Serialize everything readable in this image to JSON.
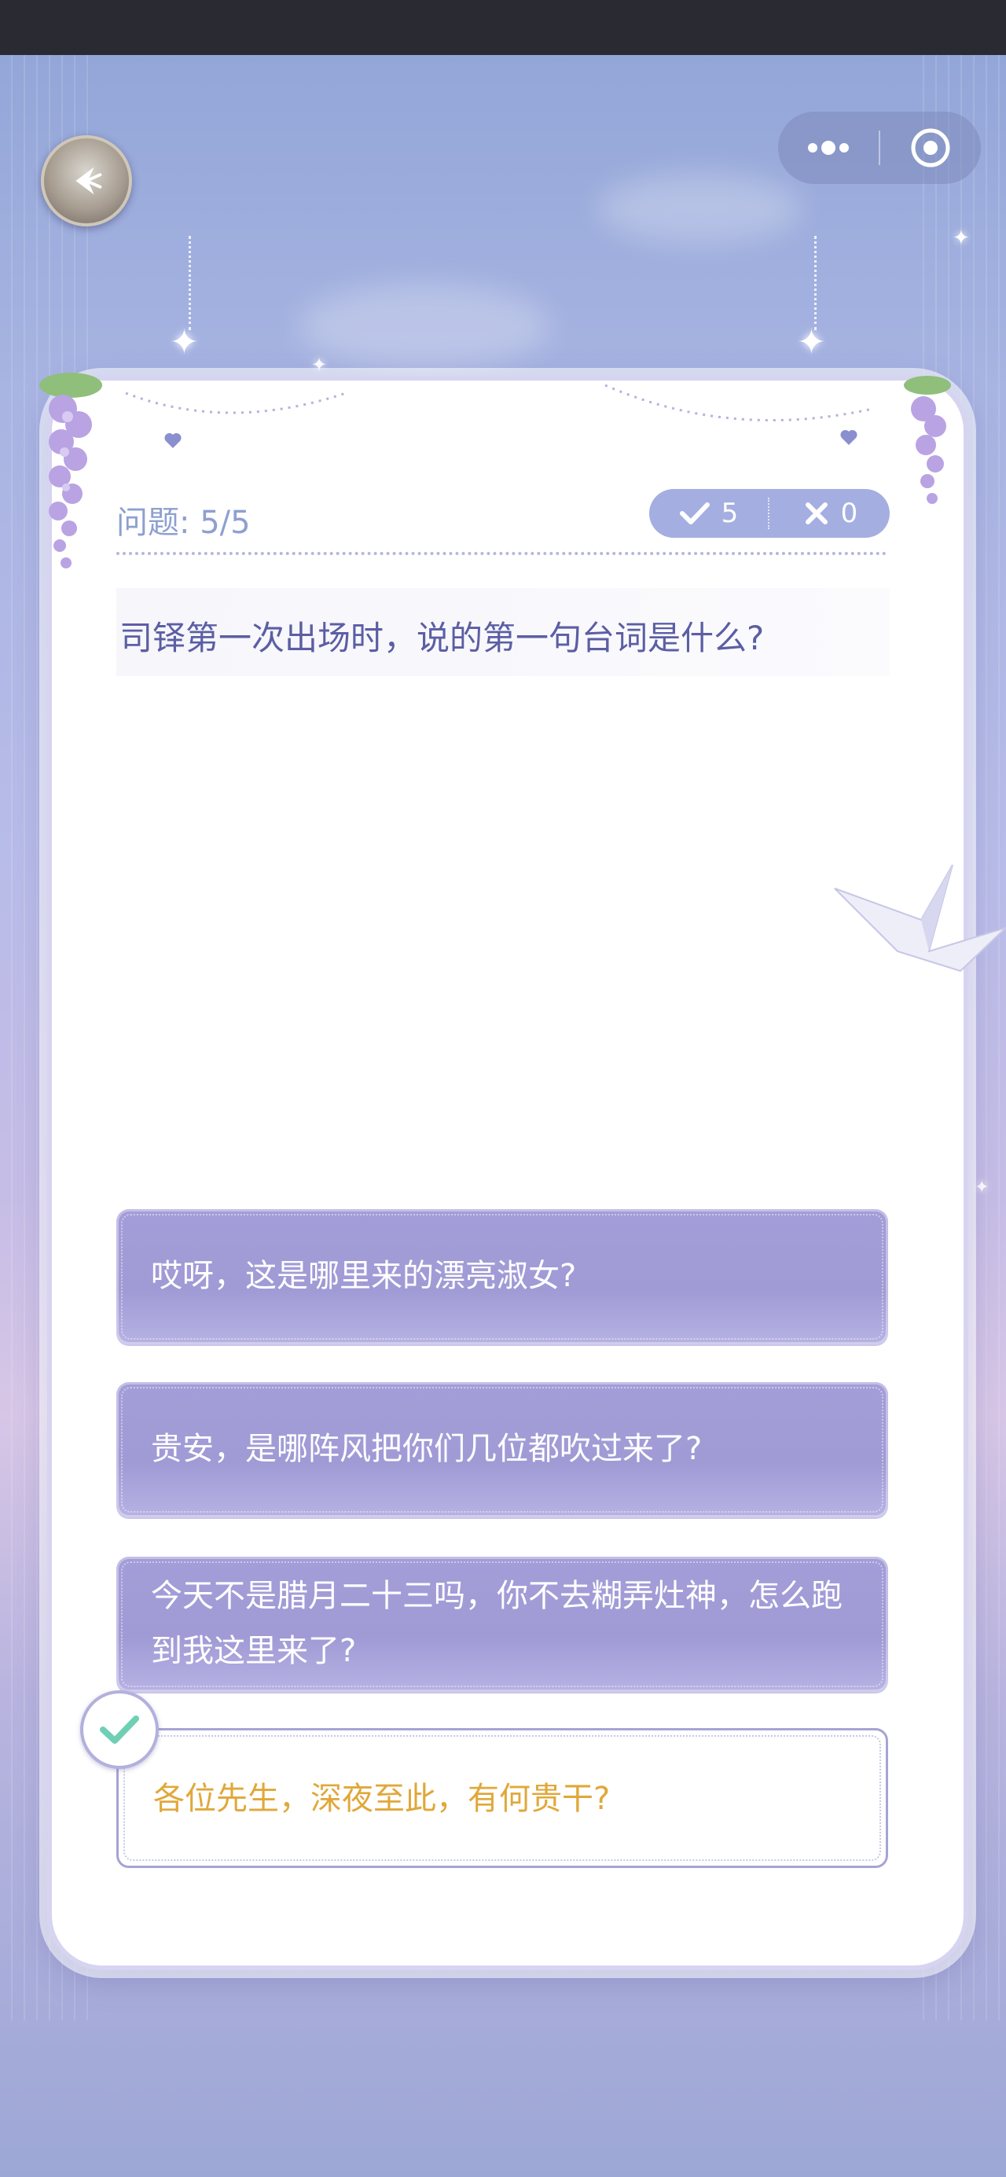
{
  "window": {
    "back_icon": "back-arrow-icon",
    "menu_icon": "more-dots-icon",
    "close_icon": "target-circle-icon"
  },
  "quiz": {
    "progress_label": "问题: 5/5",
    "correct_count": "5",
    "wrong_count": "0",
    "question": "司铎第一次出场时，说的第一句台词是什么?",
    "options": [
      {
        "text": "哎呀，这是哪里来的漂亮淑女?"
      },
      {
        "text": "贵安，是哪阵风把你们几位都吹过来了?"
      },
      {
        "text": "今天不是腊月二十三吗，你不去糊弄灶神，怎么跑到我这里来了?"
      },
      {
        "text": "各位先生，深夜至此，有何贵干?",
        "state": "correct"
      }
    ]
  },
  "colors": {
    "accent": "#a39dd8",
    "correct_text": "#e0a83a",
    "question_text": "#5c5ea4",
    "check": "#6fcfb4"
  }
}
